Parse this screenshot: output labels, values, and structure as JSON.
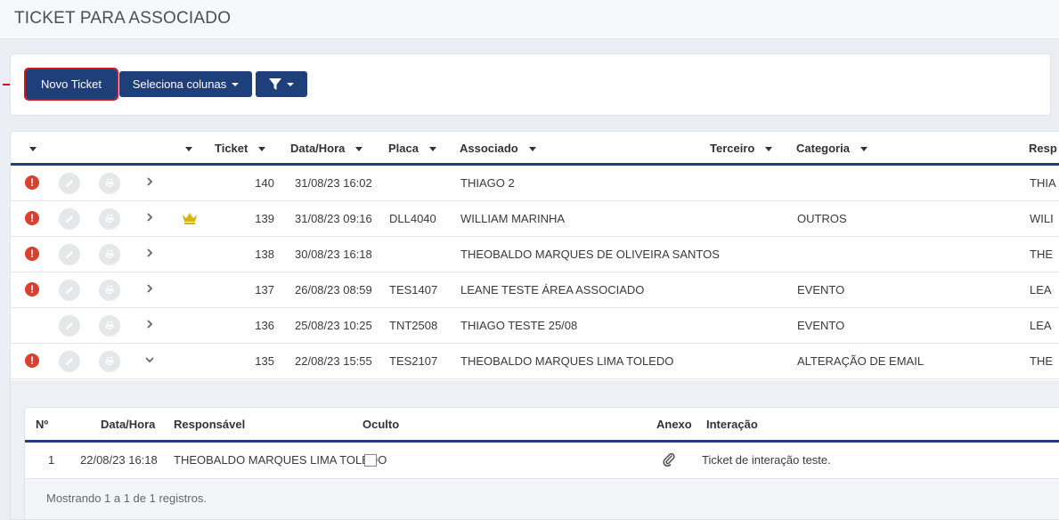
{
  "page": {
    "title": "TICKET PARA ASSOCIADO"
  },
  "toolbar": {
    "new_ticket_label": "Novo Ticket",
    "select_columns_label": "Seleciona colunas",
    "filter_icon": "filter-icon"
  },
  "colors": {
    "primary": "#1f3f7a",
    "alert": "#d9402f",
    "highlight": "#d0121f",
    "crown": "#d9b40f"
  },
  "table": {
    "headers": {
      "ticket": "Ticket",
      "datetime": "Data/Hora",
      "plate": "Placa",
      "associate": "Associado",
      "third": "Terceiro",
      "category": "Categoria",
      "responsible": "Resp"
    },
    "rows": [
      {
        "alert": true,
        "crown": false,
        "expanded": false,
        "ticket": "140",
        "datetime": "31/08/23 16:02",
        "plate": "",
        "associate": "THIAGO 2",
        "category": "",
        "responsible": "THIA"
      },
      {
        "alert": true,
        "crown": true,
        "expanded": false,
        "ticket": "139",
        "datetime": "31/08/23 09:16",
        "plate": "DLL4040",
        "associate": "WILLIAM MARINHA",
        "category": "OUTROS",
        "responsible": "WILI"
      },
      {
        "alert": true,
        "crown": false,
        "expanded": false,
        "ticket": "138",
        "datetime": "30/08/23 16:18",
        "plate": "",
        "associate": "THEOBALDO MARQUES DE OLIVEIRA SANTOS",
        "category": "",
        "responsible": "THE"
      },
      {
        "alert": true,
        "crown": false,
        "expanded": false,
        "ticket": "137",
        "datetime": "26/08/23 08:59",
        "plate": "TES1407",
        "associate": "LEANE TESTE ÁREA ASSOCIADO",
        "category": "EVENTO",
        "responsible": "LEA"
      },
      {
        "alert": false,
        "crown": false,
        "expanded": false,
        "ticket": "136",
        "datetime": "25/08/23 10:25",
        "plate": "TNT2508",
        "associate": "THIAGO TESTE 25/08",
        "category": "EVENTO",
        "responsible": "LEA"
      },
      {
        "alert": true,
        "crown": false,
        "expanded": true,
        "ticket": "135",
        "datetime": "22/08/23 15:55",
        "plate": "TES2107",
        "associate": "THEOBALDO MARQUES LIMA TOLEDO",
        "category": "ALTERAÇÃO DE EMAIL",
        "responsible": "THE"
      }
    ]
  },
  "detail": {
    "headers": {
      "no": "Nº",
      "datetime": "Data/Hora",
      "responsible": "Responsável",
      "hidden": "Oculto",
      "attachment": "Anexo",
      "interaction": "Interação"
    },
    "rows": [
      {
        "no": "1",
        "datetime": "22/08/23 16:18",
        "responsible": "THEOBALDO MARQUES LIMA TOLEDO",
        "hidden": false,
        "attachment_icon": "paperclip-icon",
        "interaction": "Ticket de interação teste."
      }
    ],
    "footer": "Mostrando 1 a 1 de 1 registros."
  }
}
